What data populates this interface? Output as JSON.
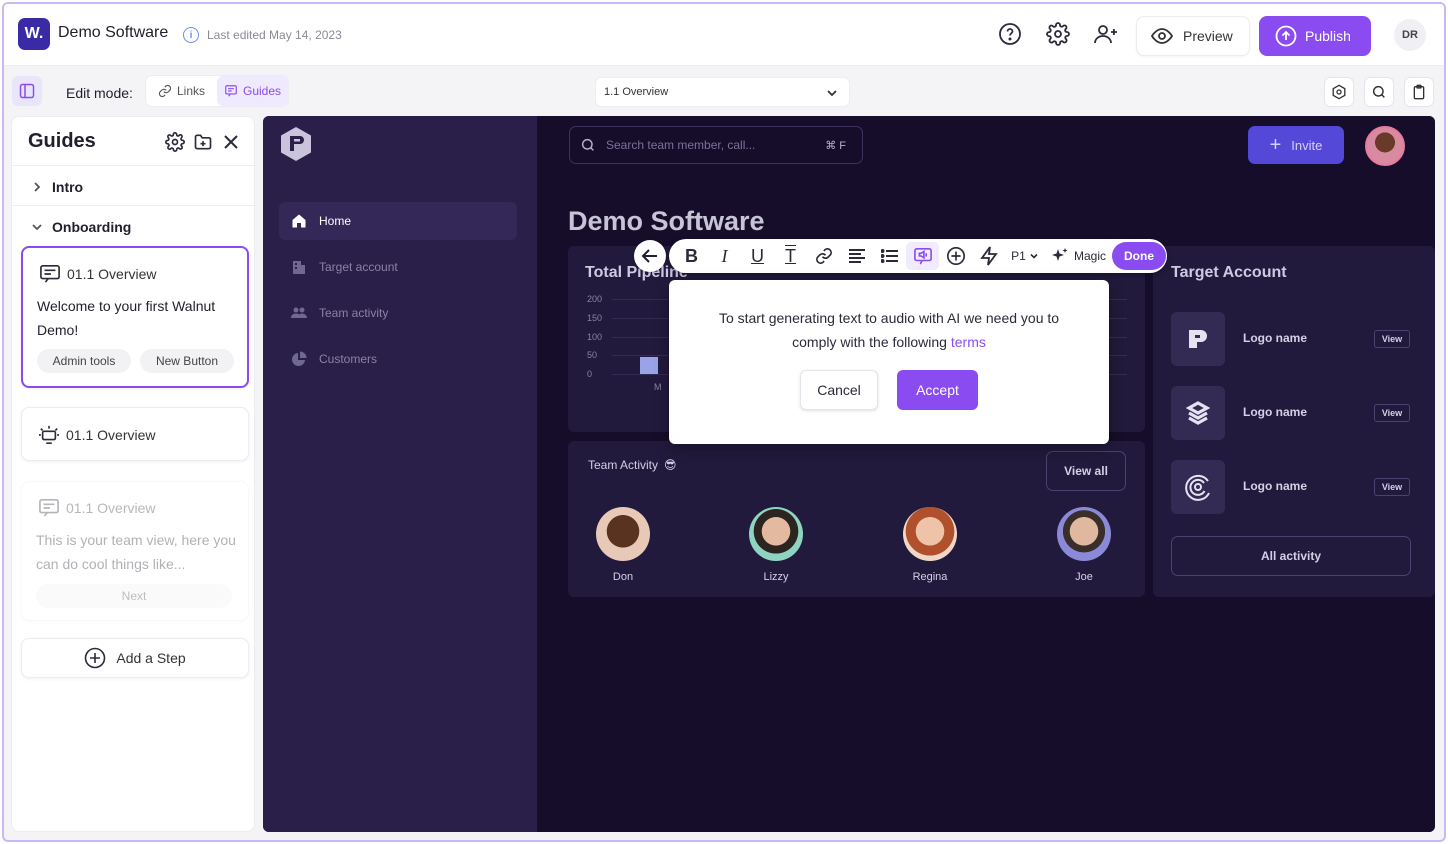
{
  "header": {
    "logo_letter": "W.",
    "app_title": "Demo Software",
    "last_edited": "Last edited May 14, 2023",
    "preview_label": "Preview",
    "publish_label": "Publish",
    "user_initials": "DR"
  },
  "editbar": {
    "edit_mode_label": "Edit mode:",
    "modes": [
      {
        "label": "Links",
        "active": false
      },
      {
        "label": "Guides",
        "active": true
      }
    ],
    "page_select_value": "1.1 Overview"
  },
  "guides": {
    "title": "Guides",
    "sections": [
      {
        "label": "Intro",
        "expanded": false
      },
      {
        "label": "Onboarding",
        "expanded": true
      }
    ],
    "steps": [
      {
        "title": "01.1 Overview",
        "text": "Welcome to your first Walnut Demo!",
        "chips": [
          "Admin tools",
          "New Button"
        ]
      },
      {
        "title": "01.1 Overview"
      },
      {
        "title": "01.1 Overview",
        "text": "This is your team view, here you can do cool things like...",
        "next_label": "Next"
      }
    ],
    "add_step_label": "Add a Step"
  },
  "demo": {
    "search_placeholder": "Search team member, call...",
    "search_shortcut": "⌘ F",
    "invite_label": "Invite",
    "nav": [
      {
        "label": "Home",
        "active": true
      },
      {
        "label": "Target account",
        "active": false
      },
      {
        "label": "Team activity",
        "active": false
      },
      {
        "label": "Customers",
        "active": false
      }
    ],
    "page_title": "Demo Software",
    "pipeline": {
      "title": "Total Pipeline",
      "y_ticks": [
        "200",
        "150",
        "100",
        "50",
        "0"
      ],
      "x_label_partial": "M",
      "bar_value": 45
    },
    "team_activity": {
      "title": "Team Activity",
      "emoji": "😎",
      "view_all_label": "View all",
      "people": [
        "Don",
        "Lizzy",
        "Regina",
        "Joe"
      ]
    },
    "target_account": {
      "title": "Target Account",
      "rows": [
        {
          "name": "Logo name",
          "view": "View"
        },
        {
          "name": "Logo name",
          "view": "View"
        },
        {
          "name": "Logo name",
          "view": "View"
        }
      ],
      "all_activity_label": "All activity"
    }
  },
  "toolbar": {
    "p1_label": "P1",
    "magic_label": "Magic",
    "done_label": "Done"
  },
  "popup": {
    "text": "To start generating text to audio with AI we need you to comply with the following",
    "link_text": "terms",
    "cancel_label": "Cancel",
    "accept_label": "Accept"
  }
}
